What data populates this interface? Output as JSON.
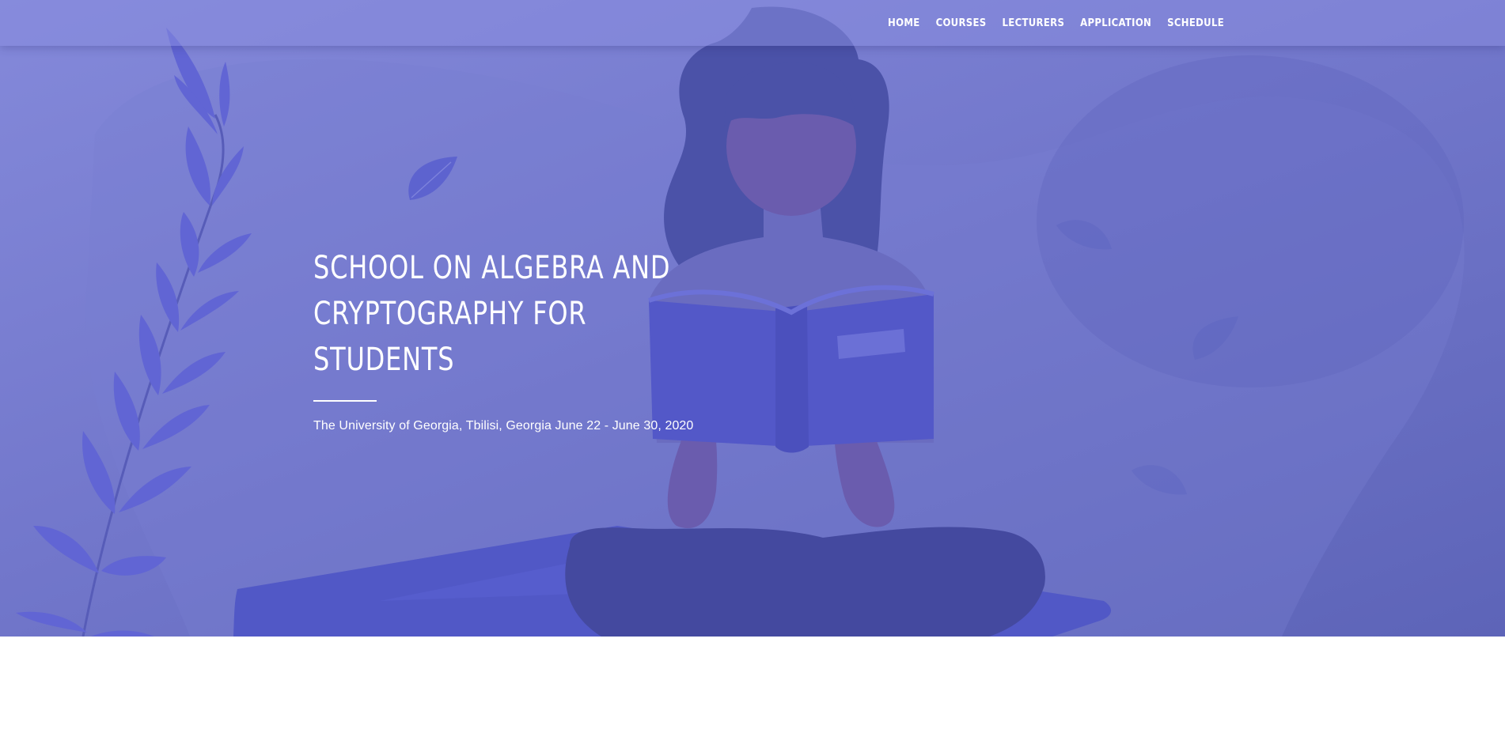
{
  "nav": {
    "items": [
      {
        "label": "HOME"
      },
      {
        "label": "COURSES"
      },
      {
        "label": "LECTURERS"
      },
      {
        "label": "APPLICATION"
      },
      {
        "label": "SCHEDULE"
      }
    ]
  },
  "hero": {
    "title_line1": "SCHOOL ON ALGEBRA AND",
    "title_line2": "CRYPTOGRAPHY FOR STUDENTS",
    "subtitle": "The University of Georgia, Tbilisi, Georgia June 22 - June 30, 2020"
  },
  "colors": {
    "hero_gradient_start": "#8489da",
    "hero_gradient_end": "#5d64b8",
    "text": "#ffffff"
  },
  "icons": {
    "illustration": "woman-reading-book-illustration",
    "plant": "leaf-branch-icon"
  }
}
